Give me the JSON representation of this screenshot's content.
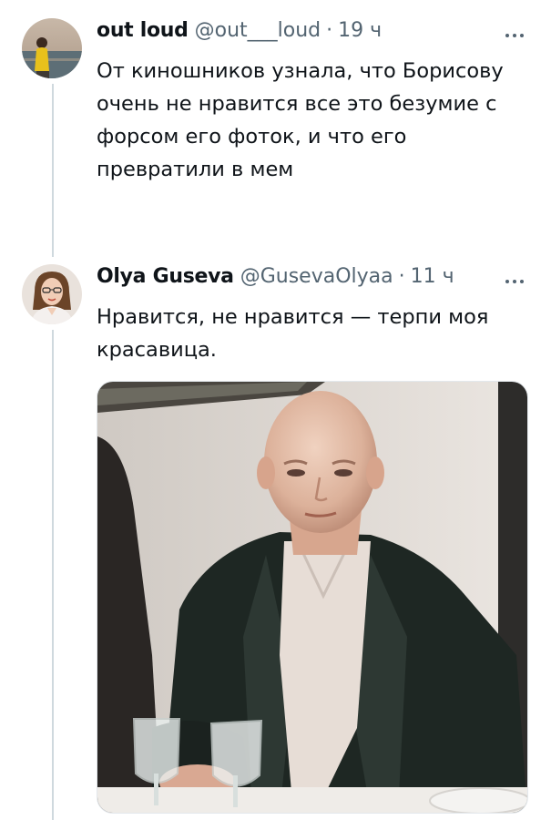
{
  "tweets": [
    {
      "name": "out loud",
      "handle": "@out___loud",
      "separator": "·",
      "time": "19 ч",
      "lines": [
        "От киношников узнала, что Борисову",
        "очень не нравится все это безумие с",
        "форсом его фоток, и что его",
        "превратили в мем"
      ]
    },
    {
      "name": "Olya Guseva",
      "handle": "@GusevaOlyaa",
      "separator": "·",
      "time": "11 ч",
      "lines": [
        "Нравится, не нравится — терпи моя",
        "красавица."
      ]
    }
  ],
  "icons": {
    "more": "more-horizontal-icon"
  },
  "colors": {
    "text": "#0f1419",
    "secondary": "#536471",
    "thread_line": "#cfd9de"
  }
}
